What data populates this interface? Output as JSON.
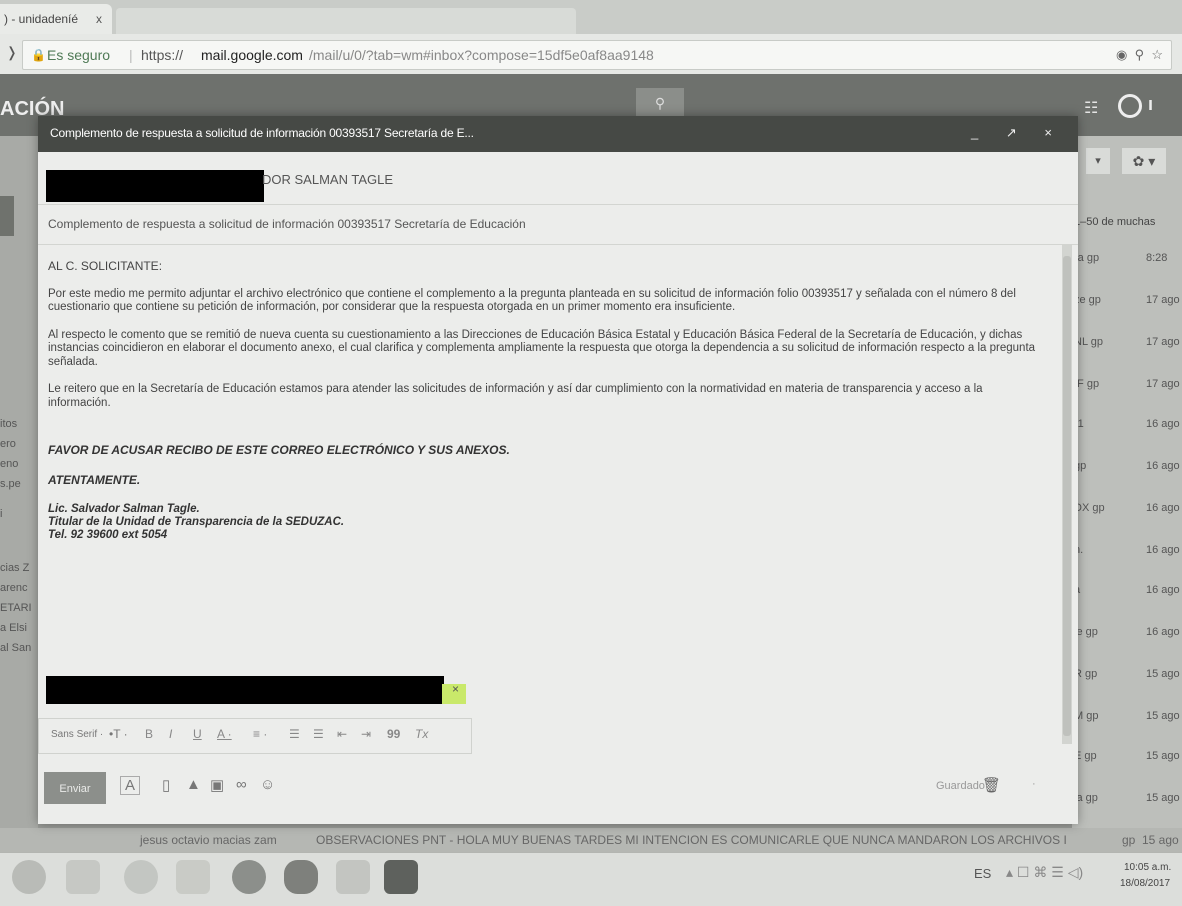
{
  "browser": {
    "tab_title": ") - unidadeníé",
    "tab_close": "x",
    "secure_label": "Es seguro",
    "url_prefix": "https://",
    "url_host": "mail.google.com",
    "url_rest": "/mail/u/0/?tab=wm#inbox?compose=15df5e0af8aa9148",
    "back_glyph": "❭"
  },
  "gmail": {
    "section_label": "ACIÓN",
    "mail_count": "1–50 de muchas",
    "right_rows": [
      {
        "s": "ra  gp",
        "d": "8:28"
      },
      {
        "s": "ze  gp",
        "d": "17 ago"
      },
      {
        "s": "NL  gp",
        "d": "17 ago"
      },
      {
        "s": "IF  gp",
        "d": "17 ago"
      },
      {
        "s": "r1",
        "d": "16 ago"
      },
      {
        "s": "   gp",
        "d": "16 ago"
      },
      {
        "s": "DX  gp",
        "d": "16 ago"
      },
      {
        "s": "n.",
        "d": "16 ago"
      },
      {
        "s": "a",
        "d": "16 ago"
      },
      {
        "s": "le  gp",
        "d": "16 ago"
      },
      {
        "s": "R  gp",
        "d": "15 ago"
      },
      {
        "s": "M  gp",
        "d": "15 ago"
      },
      {
        "s": "E  gp",
        "d": "15 ago"
      },
      {
        "s": "la  gp",
        "d": "15 ago"
      }
    ],
    "left_rows": [
      "itos",
      "ero",
      "eno",
      "s.pe",
      "i",
      "cias Z",
      "arenc",
      "ETARI",
      "a Elsi",
      "al San"
    ],
    "bottom_row": {
      "sender": "jesus octavio macias zam",
      "subject": "OBSERVACIONES PNT - HOLA MUY BUENAS TARDES MI INTENCION ES COMUNICARLE QUE NUNCA MANDARON LOS ARCHIVOS I",
      "tag": "gp",
      "date": "15 ago"
    }
  },
  "compose": {
    "title": "Complemento de respuesta a solicitud de información 00393517 Secretaría de E...",
    "window_controls": "_ ↗ ×",
    "to_visible": "DOR SALMAN TAGLE",
    "subject": "Complemento de respuesta a solicitud de información 00393517 Secretaría de Educación",
    "greeting": "AL C. SOLICITANTE:",
    "para1": "Por este medio me permito adjuntar el archivo electrónico que contiene el complemento a la pregunta planteada en su solicitud de información folio 00393517 y señalada con el número 8 del cuestionario que contiene su petición de información, por considerar que la respuesta otorgada en un primer momento era insuficiente.",
    "para2": "Al respecto le comento que se remitió de nueva cuenta su cuestionamiento a las Direcciones de Educación Básica Estatal y Educación Básica Federal de la Secretaría de Educación, y dichas instancias coincidieron en elaborar el documento anexo, el cual clarifica y complementa ampliamente la respuesta que otorga la dependencia a su solicitud de información respecto a la pregunta señalada.",
    "para3": "Le reitero que en la Secretaría de Educación estamos para atender las solicitudes de información y así dar cumplimiento con la normatividad en materia de transparencia y acceso a la información.",
    "ack": "FAVOR DE ACUSAR RECIBO DE ESTE CORREO ELECTRÓNICO Y SUS ANEXOS.",
    "closing": "ATENTAMENTE.",
    "sig_name": "Lic. Salvador Salman Tagle.",
    "sig_title": "Titular de la Unidad de Transparencia de la SEDUZAC.",
    "sig_tel": "Tel. 92 39600 ext 5054",
    "attach_close": "×",
    "format": {
      "font": "Sans Serif",
      "font_arrow": "·",
      "size": "•T ·",
      "bold": "B",
      "italic": "I",
      "underline": "U",
      "color": "A ·",
      "align": "≡ ·",
      "numbered": "☰",
      "bulleted": "☰",
      "indent_less": "⇤",
      "indent_more": "⇥",
      "quote": "99",
      "clear": "Tx"
    },
    "send_label": "Enviar",
    "saved_label": "Guardado",
    "more_label": "·"
  },
  "taskbar": {
    "lang": "ES",
    "tray": "▴ ☐ ⌘ ☰ ◁)",
    "time": "10:05 a.m.",
    "date": "18/08/2017"
  }
}
